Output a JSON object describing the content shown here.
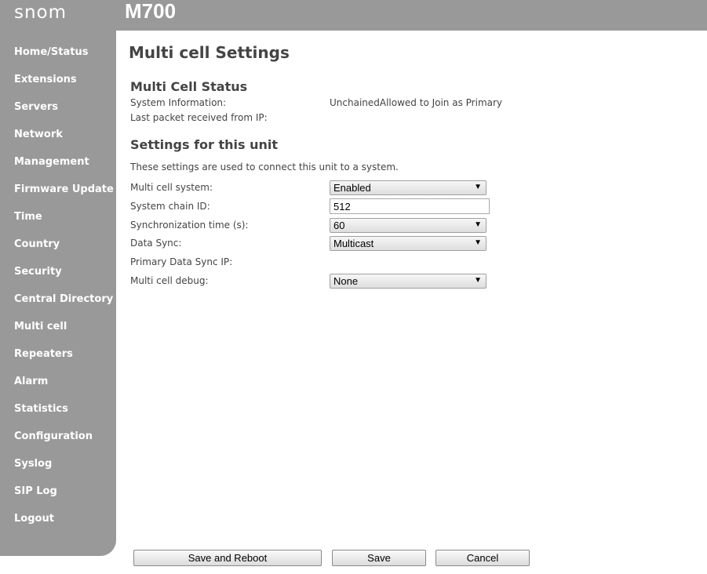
{
  "header": {
    "logo": "snom",
    "model": "M700"
  },
  "sidebar": {
    "items": [
      {
        "label": "Home/Status"
      },
      {
        "label": "Extensions"
      },
      {
        "label": "Servers"
      },
      {
        "label": "Network"
      },
      {
        "label": "Management"
      },
      {
        "label": "Firmware Update"
      },
      {
        "label": "Time"
      },
      {
        "label": "Country"
      },
      {
        "label": "Security"
      },
      {
        "label": "Central Directory"
      },
      {
        "label": "Multi cell"
      },
      {
        "label": "Repeaters"
      },
      {
        "label": "Alarm"
      },
      {
        "label": "Statistics"
      },
      {
        "label": "Configuration"
      },
      {
        "label": "Syslog"
      },
      {
        "label": "SIP Log"
      },
      {
        "label": "Logout"
      }
    ]
  },
  "main": {
    "title": "Multi cell Settings",
    "status": {
      "heading": "Multi Cell Status",
      "system_info_label": "System Information:",
      "system_info_value": "UnchainedAllowed to Join as Primary",
      "last_packet_label": "Last packet received from IP:"
    },
    "settings": {
      "heading": "Settings for this unit",
      "description": "These settings are used to connect this unit to a system.",
      "multi_cell_system_label": "Multi cell system:",
      "multi_cell_system_value": "Enabled",
      "chain_id_label": "System chain ID:",
      "chain_id_value": "512",
      "sync_time_label": "Synchronization time (s):",
      "sync_time_value": "60",
      "data_sync_label": "Data Sync:",
      "data_sync_value": "Multicast",
      "primary_ip_label": "Primary Data Sync IP:",
      "debug_label": "Multi cell debug:",
      "debug_value": "None"
    }
  },
  "buttons": {
    "save_reboot": "Save and Reboot",
    "save": "Save",
    "cancel": "Cancel"
  },
  "icons": {
    "dropdown": "▼"
  }
}
